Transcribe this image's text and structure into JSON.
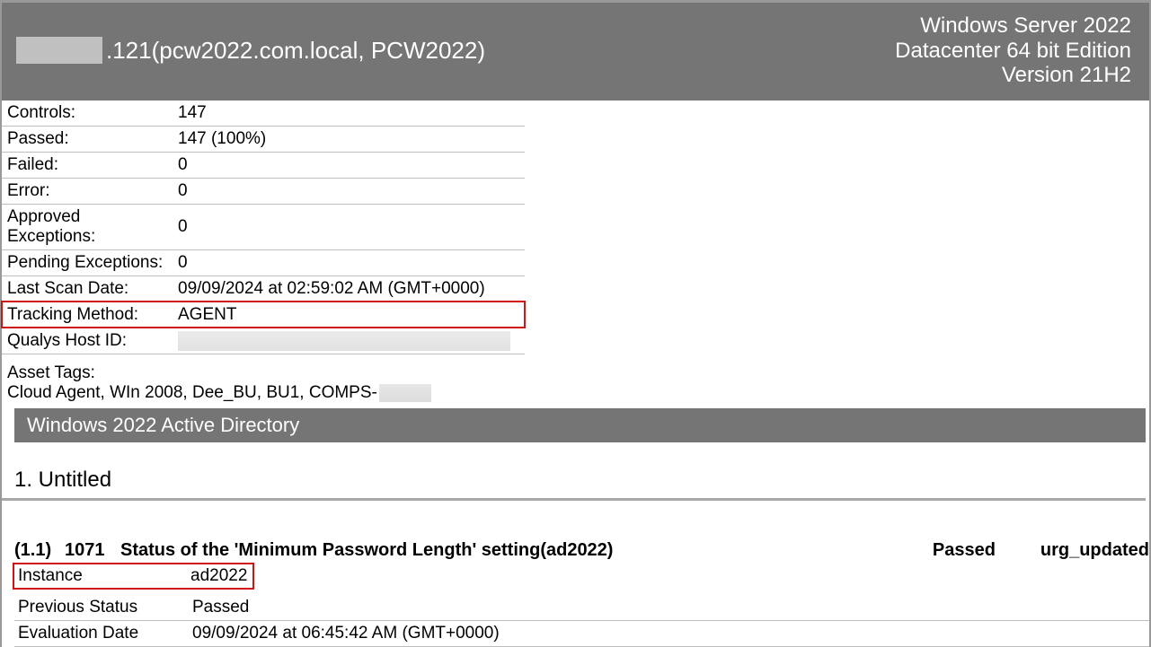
{
  "header": {
    "ip_suffix": ".121",
    "host_paren": " (pcw2022.com.local, PCW2022)",
    "os_line1": "Windows Server 2022",
    "os_line2": "Datacenter 64 bit Edition",
    "os_line3": "Version 21H2"
  },
  "summary": {
    "controls_label": "Controls:",
    "controls_value": "147",
    "passed_label": "Passed:",
    "passed_value": "147 (100%)",
    "failed_label": "Failed:",
    "failed_value": "0",
    "error_label": "Error:",
    "error_value": "0",
    "approved_ex_label": "Approved Exceptions:",
    "approved_ex_value": "0",
    "pending_ex_label": "Pending Exceptions:",
    "pending_ex_value": "0",
    "last_scan_label": "Last Scan Date:",
    "last_scan_value": "09/09/2024 at 02:59:02 AM (GMT+0000)",
    "tracking_label": "Tracking Method:",
    "tracking_value": "AGENT",
    "hostid_label": "Qualys Host ID:"
  },
  "asset_tags": {
    "label": "Asset Tags:",
    "tags_text": "Cloud Agent, WIn 2008, Dee_BU, BU1, COMPS-"
  },
  "section": {
    "bar": "Windows 2022 Active Directory",
    "sub": "1. Untitled"
  },
  "control": {
    "num": "(1.1)",
    "id": "1071",
    "title": "Status of the 'Minimum Password Length' setting(ad2022)",
    "status": "Passed",
    "urg": "urg_updated",
    "instance_label": "Instance",
    "instance_value": "ad2022",
    "prev_label": "Previous Status",
    "prev_value": "Passed",
    "eval_label": "Evaluation Date",
    "eval_value": "09/09/2024 at 06:45:42 AM (GMT+0000)"
  },
  "highlight_color": "#d11313"
}
